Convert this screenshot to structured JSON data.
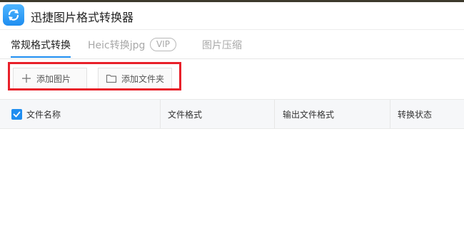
{
  "app": {
    "title": "迅捷图片格式转换器",
    "logo_icon": "refresh-icon",
    "accent_color": "#1e8df0"
  },
  "tabs": [
    {
      "label": "常规格式转换",
      "active": true
    },
    {
      "label": "Heic转换jpg",
      "badge": "VIP",
      "active": false
    },
    {
      "label": "图片压缩",
      "active": false
    }
  ],
  "toolbar": {
    "add_image_label": "添加图片",
    "add_image_icon": "plus-icon",
    "add_folder_label": "添加文件夹",
    "add_folder_icon": "folder-icon",
    "highlight_color": "#e8202a"
  },
  "table": {
    "select_all_checked": true,
    "columns": [
      "文件名称",
      "文件格式",
      "输出文件格式",
      "转换状态"
    ],
    "rows": []
  }
}
